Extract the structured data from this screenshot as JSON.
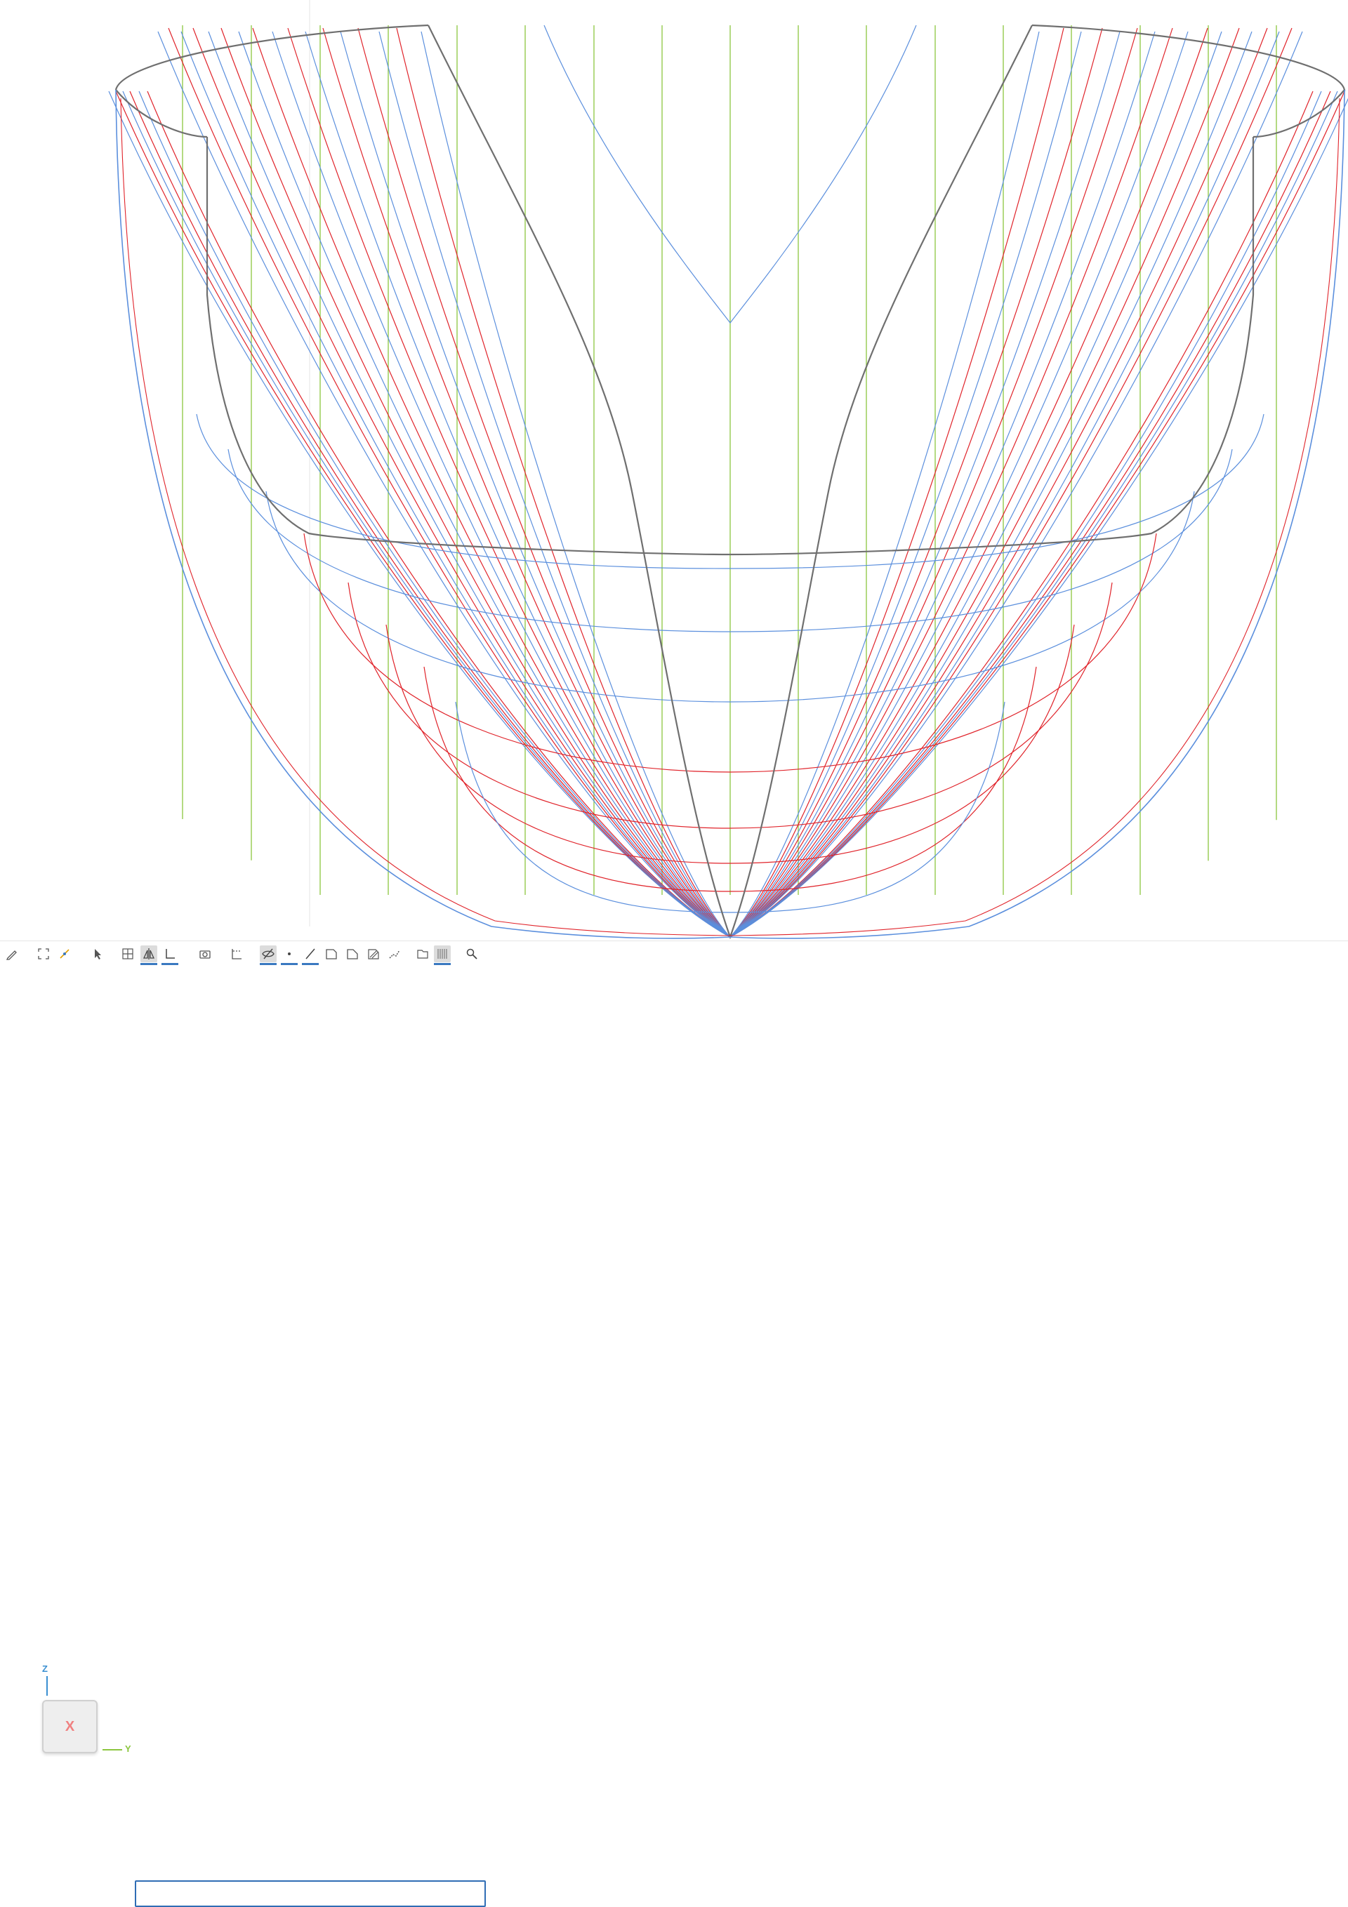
{
  "viewport": {
    "title": "",
    "colors": {
      "outline": "#6f6f6f",
      "buttock_lines": "#8cc63f",
      "waterlines": "#e0232a",
      "sections": "#5b8fdd"
    }
  },
  "view_cube": {
    "face_label": "X",
    "axis_z_label": "Z",
    "axis_y_label": "Y",
    "colors": {
      "z": "#3a8fd1",
      "y": "#8cc63f",
      "x": "#f08080"
    }
  },
  "toolbar": {
    "buttons": [
      {
        "icon": "pencil-icon"
      },
      {
        "icon": "fit-view-icon"
      },
      {
        "icon": "snap-icon"
      },
      {
        "icon": "select-arrow-icon"
      },
      {
        "icon": "grid-view-icon"
      },
      {
        "icon": "symmetry-icon",
        "active": true,
        "underline": true
      },
      {
        "icon": "axes-icon",
        "underline": true
      },
      {
        "icon": "camera-icon"
      },
      {
        "icon": "dimension-icon"
      },
      {
        "icon": "hide-icon",
        "active": true,
        "underline": true
      },
      {
        "icon": "point-icon",
        "underline": true
      },
      {
        "icon": "line-icon",
        "underline": true
      },
      {
        "icon": "surface-icon"
      },
      {
        "icon": "surface-edit-icon"
      },
      {
        "icon": "surface-hatch-icon"
      },
      {
        "icon": "polyline-icon"
      },
      {
        "icon": "panel-icon"
      },
      {
        "icon": "stations-icon",
        "active": true,
        "underline": true
      },
      {
        "icon": "zoom-icon"
      }
    ]
  }
}
